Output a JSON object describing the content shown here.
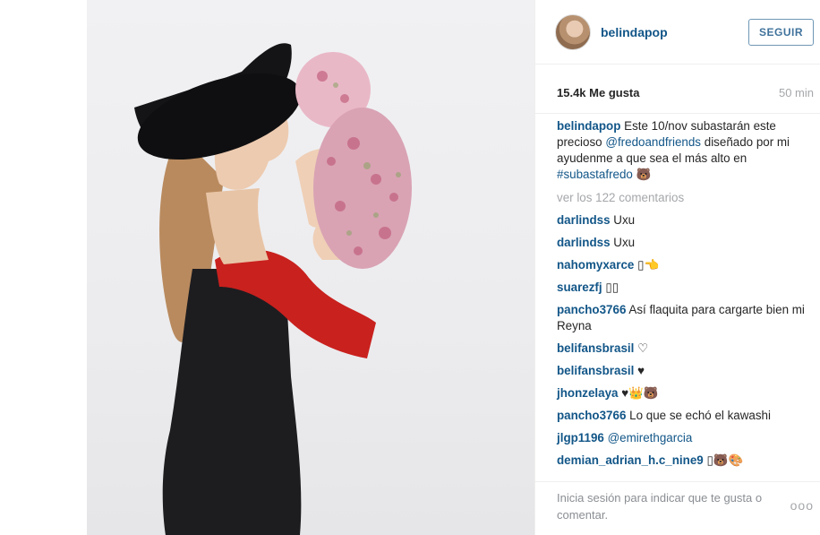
{
  "post": {
    "author": "belindapop",
    "follow_label": "SEGUIR",
    "likes": "15.4k Me gusta",
    "time_ago": "50 min"
  },
  "caption": {
    "user": "belindapop",
    "text_1": "Este 10/nov subastarán este precioso",
    "mention": "@fredoandfriends",
    "text_2": "diseñado por mi ayudenme a que sea el más alto en",
    "hashtag": "#subastafredo",
    "emoji": "🐻"
  },
  "view_more": "ver los 122 comentarios",
  "comments": [
    {
      "user": "darlindss",
      "text": "Uxu"
    },
    {
      "user": "darlindss",
      "text": "Uxu"
    },
    {
      "user": "nahomyxarce",
      "text": "▯👈"
    },
    {
      "user": "suarezfj",
      "text": "▯▯"
    },
    {
      "user": "pancho3766",
      "text": "Así flaquita para cargarte bien mi Reyna"
    },
    {
      "user": "belifansbrasil",
      "text": "♡"
    },
    {
      "user": "belifansbrasil",
      "text": "♥"
    },
    {
      "user": "jhonzelaya",
      "text": "♥👑🐻"
    },
    {
      "user": "pancho3766",
      "text": "Lo que se echó el kawashi"
    },
    {
      "user": "jlgp1196",
      "text": "@emirethgarcia"
    },
    {
      "user": "demian_adrian_h.c_nine9",
      "text": "▯🐻🎨"
    }
  ],
  "footer": {
    "login_prompt": "Inicia sesión para indicar que te gusta o comentar.",
    "more_options": "ooo"
  },
  "colors": {
    "link_blue": "#125688",
    "follow_border": "#6f97b6",
    "muted": "#a5a7aa"
  }
}
